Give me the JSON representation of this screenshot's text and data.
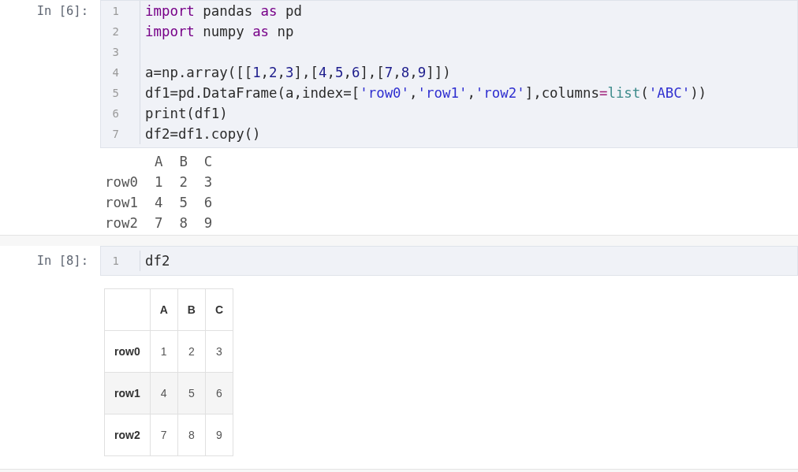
{
  "cells": [
    {
      "prompt": "In [6]:",
      "code_lines": [
        {
          "number": "1",
          "tokens": [
            {
              "kind": "keyword",
              "text": "import"
            },
            {
              "kind": "plain",
              "text": " pandas "
            },
            {
              "kind": "keyword",
              "text": "as"
            },
            {
              "kind": "plain",
              "text": " pd"
            }
          ]
        },
        {
          "number": "2",
          "tokens": [
            {
              "kind": "keyword",
              "text": "import"
            },
            {
              "kind": "plain",
              "text": " numpy "
            },
            {
              "kind": "keyword",
              "text": "as"
            },
            {
              "kind": "plain",
              "text": " np"
            }
          ]
        },
        {
          "number": "3"
        },
        {
          "number": "4",
          "tokens": [
            {
              "kind": "plain",
              "text": "a=np.array([["
            },
            {
              "kind": "number",
              "text": "1"
            },
            {
              "kind": "plain",
              "text": ","
            },
            {
              "kind": "number",
              "text": "2"
            },
            {
              "kind": "plain",
              "text": ","
            },
            {
              "kind": "number",
              "text": "3"
            },
            {
              "kind": "plain",
              "text": "],["
            },
            {
              "kind": "number",
              "text": "4"
            },
            {
              "kind": "plain",
              "text": ","
            },
            {
              "kind": "number",
              "text": "5"
            },
            {
              "kind": "plain",
              "text": ","
            },
            {
              "kind": "number",
              "text": "6"
            },
            {
              "kind": "plain",
              "text": "],["
            },
            {
              "kind": "number",
              "text": "7"
            },
            {
              "kind": "plain",
              "text": ","
            },
            {
              "kind": "number",
              "text": "8"
            },
            {
              "kind": "plain",
              "text": ","
            },
            {
              "kind": "number",
              "text": "9"
            },
            {
              "kind": "plain",
              "text": "]])"
            }
          ]
        },
        {
          "number": "5",
          "tokens": [
            {
              "kind": "plain",
              "text": "df1=pd.DataFrame(a,index=["
            },
            {
              "kind": "string",
              "text": "'row0'"
            },
            {
              "kind": "plain",
              "text": ","
            },
            {
              "kind": "string",
              "text": "'row1'"
            },
            {
              "kind": "plain",
              "text": ","
            },
            {
              "kind": "string",
              "text": "'row2'"
            },
            {
              "kind": "plain",
              "text": "],columns"
            },
            {
              "kind": "operator",
              "text": "="
            },
            {
              "kind": "builtin",
              "text": "list"
            },
            {
              "kind": "plain",
              "text": "("
            },
            {
              "kind": "string",
              "text": "'ABC'"
            },
            {
              "kind": "plain",
              "text": "))"
            }
          ]
        },
        {
          "number": "6",
          "tokens": [
            {
              "kind": "plain",
              "text": "print(df1)"
            }
          ]
        },
        {
          "number": "7",
          "tokens": [
            {
              "kind": "plain",
              "text": "df2=df1.copy()"
            }
          ]
        }
      ],
      "output": {
        "kind": "text",
        "columns": [
          "A",
          "B",
          "C"
        ],
        "rows": [
          {
            "index": "row0",
            "values": [
              "1",
              "2",
              "3"
            ]
          },
          {
            "index": "row1",
            "values": [
              "4",
              "5",
              "6"
            ]
          },
          {
            "index": "row2",
            "values": [
              "7",
              "8",
              "9"
            ]
          }
        ]
      }
    },
    {
      "prompt": "In [8]:",
      "code_lines": [
        {
          "number": "1",
          "tokens": [
            {
              "kind": "plain",
              "text": "df2"
            }
          ]
        }
      ],
      "output": {
        "kind": "table",
        "columns": [
          "A",
          "B",
          "C"
        ],
        "rows": [
          {
            "index": "row0",
            "values": [
              "1",
              "2",
              "3"
            ]
          },
          {
            "index": "row1",
            "values": [
              "4",
              "5",
              "6"
            ]
          },
          {
            "index": "row2",
            "values": [
              "7",
              "8",
              "9"
            ]
          }
        ]
      }
    }
  ]
}
